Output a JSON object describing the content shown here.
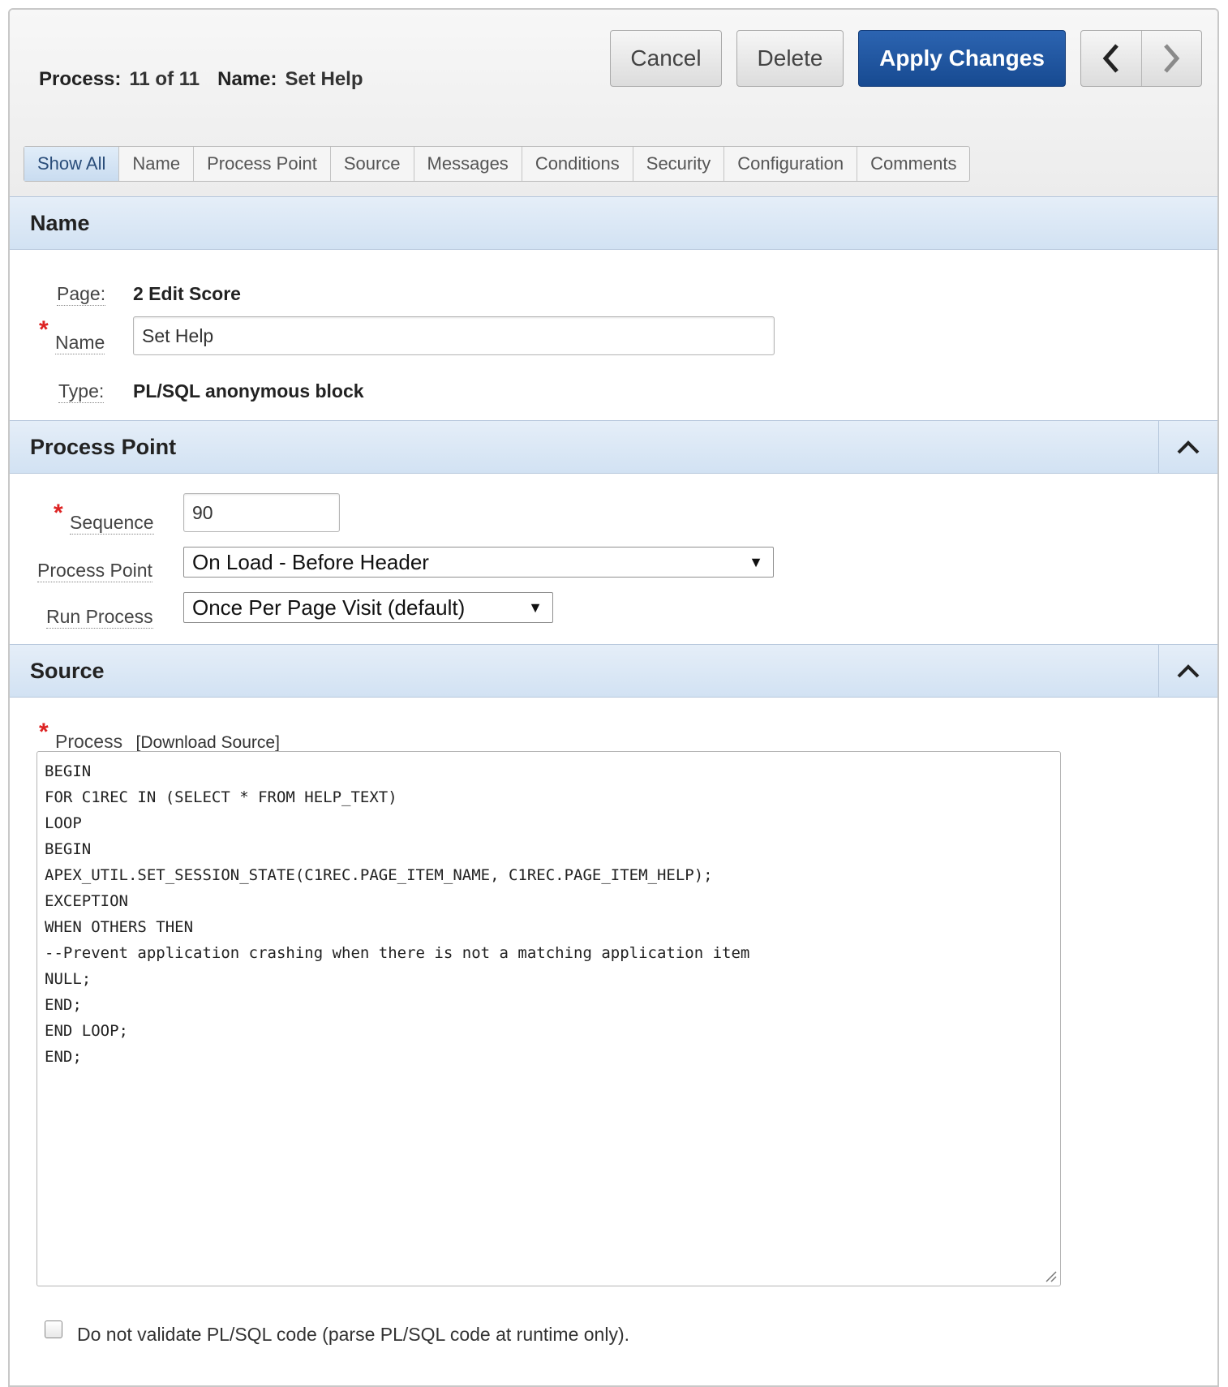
{
  "header": {
    "process_label": "Process:",
    "process_value": "11 of 11",
    "name_label": "Name:",
    "name_value": "Set Help",
    "cancel_label": "Cancel",
    "delete_label": "Delete",
    "apply_label": "Apply Changes",
    "prev_icon": "chevron-left-icon",
    "next_icon": "chevron-right-icon"
  },
  "tabs": [
    {
      "label": "Show All",
      "active": true
    },
    {
      "label": "Name"
    },
    {
      "label": "Process Point"
    },
    {
      "label": "Source"
    },
    {
      "label": "Messages"
    },
    {
      "label": "Conditions"
    },
    {
      "label": "Security"
    },
    {
      "label": "Configuration"
    },
    {
      "label": "Comments"
    }
  ],
  "name_section": {
    "title": "Name",
    "page_label": "Page:",
    "page_value": "2 Edit Score",
    "name_label": "Name",
    "name_value": "Set Help",
    "type_label": "Type:",
    "type_value": "PL/SQL anonymous block"
  },
  "process_point_section": {
    "title": "Process Point",
    "sequence_label": "Sequence",
    "sequence_value": "90",
    "process_point_label": "Process Point",
    "process_point_value": "On Load - Before Header",
    "run_process_label": "Run Process",
    "run_process_value": "Once Per Page Visit (default)"
  },
  "source_section": {
    "title": "Source",
    "process_label": "Process",
    "download_link": "[Download Source]",
    "code_lines": [
      "BEGIN",
      "FOR C1REC IN (SELECT * FROM HELP_TEXT)",
      "LOOP",
      "BEGIN",
      "APEX_UTIL.SET_SESSION_STATE(C1REC.PAGE_ITEM_NAME, C1REC.PAGE_ITEM_HELP);",
      "EXCEPTION",
      "WHEN OTHERS THEN",
      "--Prevent application crashing when there is not a matching application item",
      "NULL;",
      "END;",
      "END LOOP;",
      "END;"
    ],
    "validate_label": "Do not validate PL/SQL code (parse PL/SQL code at runtime only)."
  }
}
